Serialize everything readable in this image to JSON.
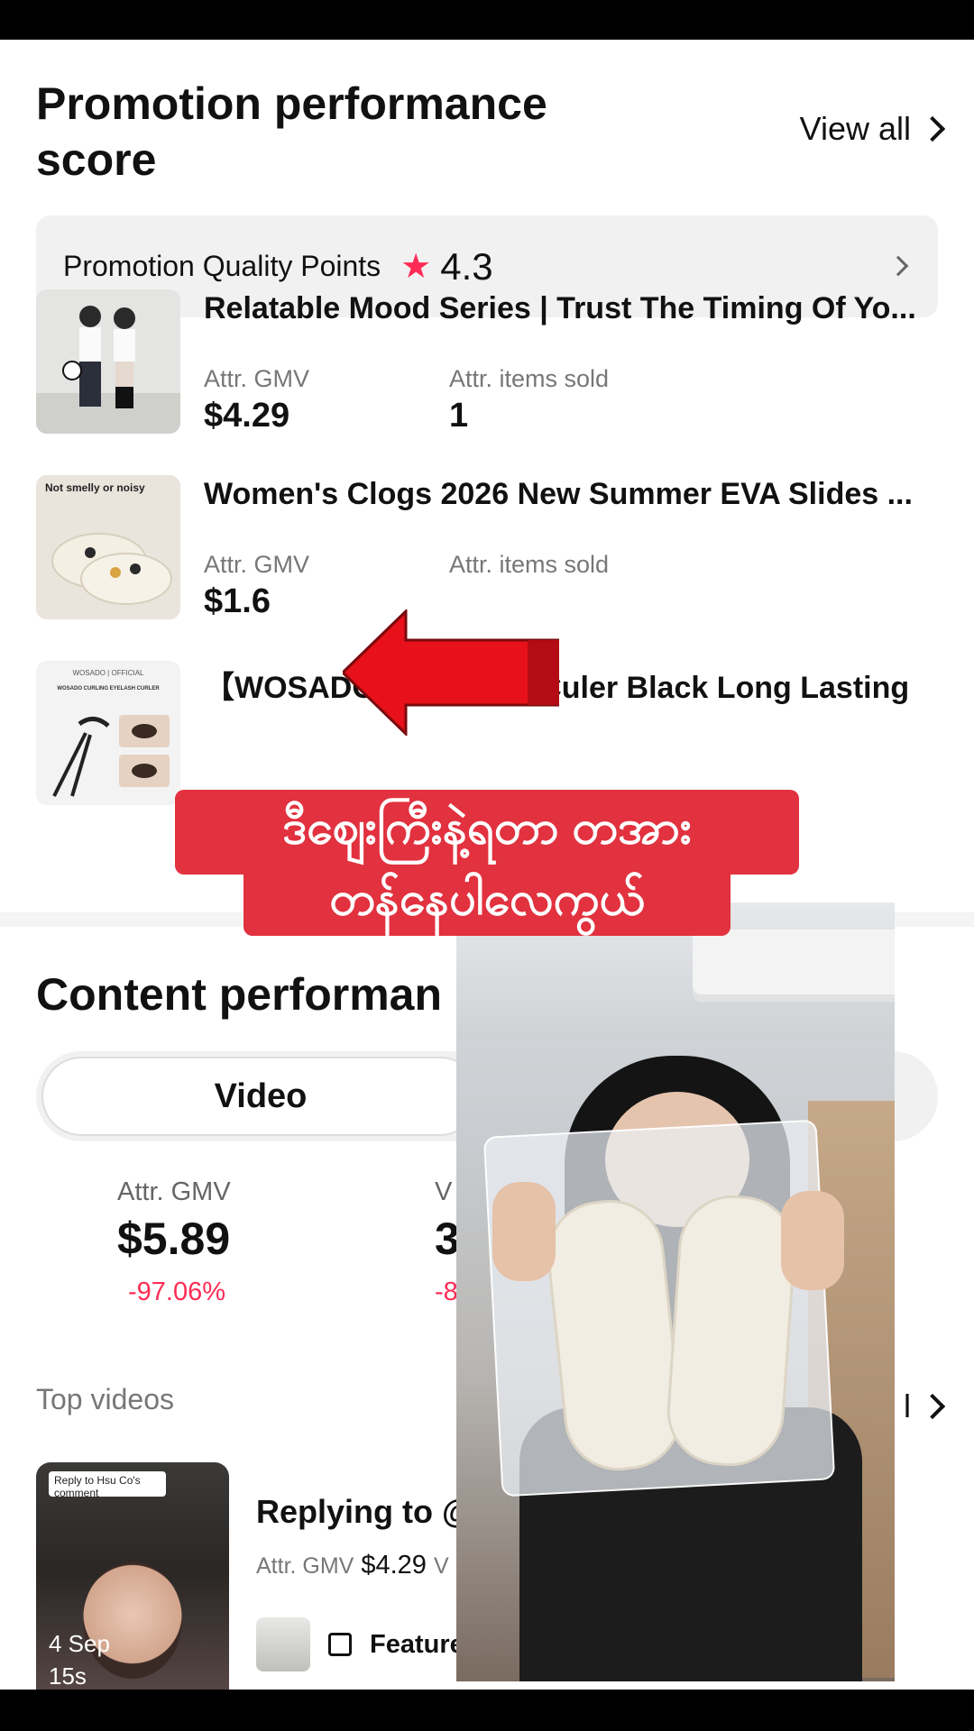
{
  "promotion": {
    "title": "Promotion performance score",
    "view_all": "View all",
    "quality_label": "Promotion Quality Points",
    "quality_score": "4.3"
  },
  "products": [
    {
      "title": "Relatable Mood Series | Trust The Timing Of Yo...",
      "gmv_label": "Attr. GMV",
      "gmv": "$4.29",
      "sold_label": "Attr. items sold",
      "sold": "1"
    },
    {
      "title": "Women's Clogs 2026 New Summer EVA Slides ...",
      "gmv_label": "Attr. GMV",
      "gmv": "$1.6",
      "sold_label": "Attr. items sold",
      "sold": ""
    },
    {
      "title": "【WOSADO】 Eyelash Culer Black Long Lasting",
      "thumb_text": "WOSADO | OFFICIAL",
      "thumb_sub": "WOSADO CURLING EYELASH CURLER"
    }
  ],
  "product_thumb_text": {
    "clogs": "Not smelly or noisy"
  },
  "content": {
    "title": "Content performan",
    "tab_video": "Video",
    "metrics": [
      {
        "label": "Attr. GMV",
        "value": "$5.89",
        "change": "-97.06%"
      },
      {
        "label": "V",
        "value": "3",
        "change": "-8"
      }
    ],
    "top_videos_label": "Top videos",
    "view_all_partial": "l"
  },
  "video": {
    "title": "Replying to @",
    "gmv_label": "Attr. GMV",
    "gmv": "$4.29",
    "gmv_trail": "V",
    "date": "4 Sep",
    "duration": "15s",
    "featured": "Featured",
    "reply_tag": "Reply to Hsu Co's comment"
  },
  "caption": {
    "line1": "ဒီဈေးကြီးနဲ့ရတာ တအား",
    "line2": "တန်နေပါလေကွယ်"
  },
  "colors": {
    "accent": "#fe2c55",
    "caption_bg": "#e2313f",
    "arrow": "#e8101a"
  }
}
